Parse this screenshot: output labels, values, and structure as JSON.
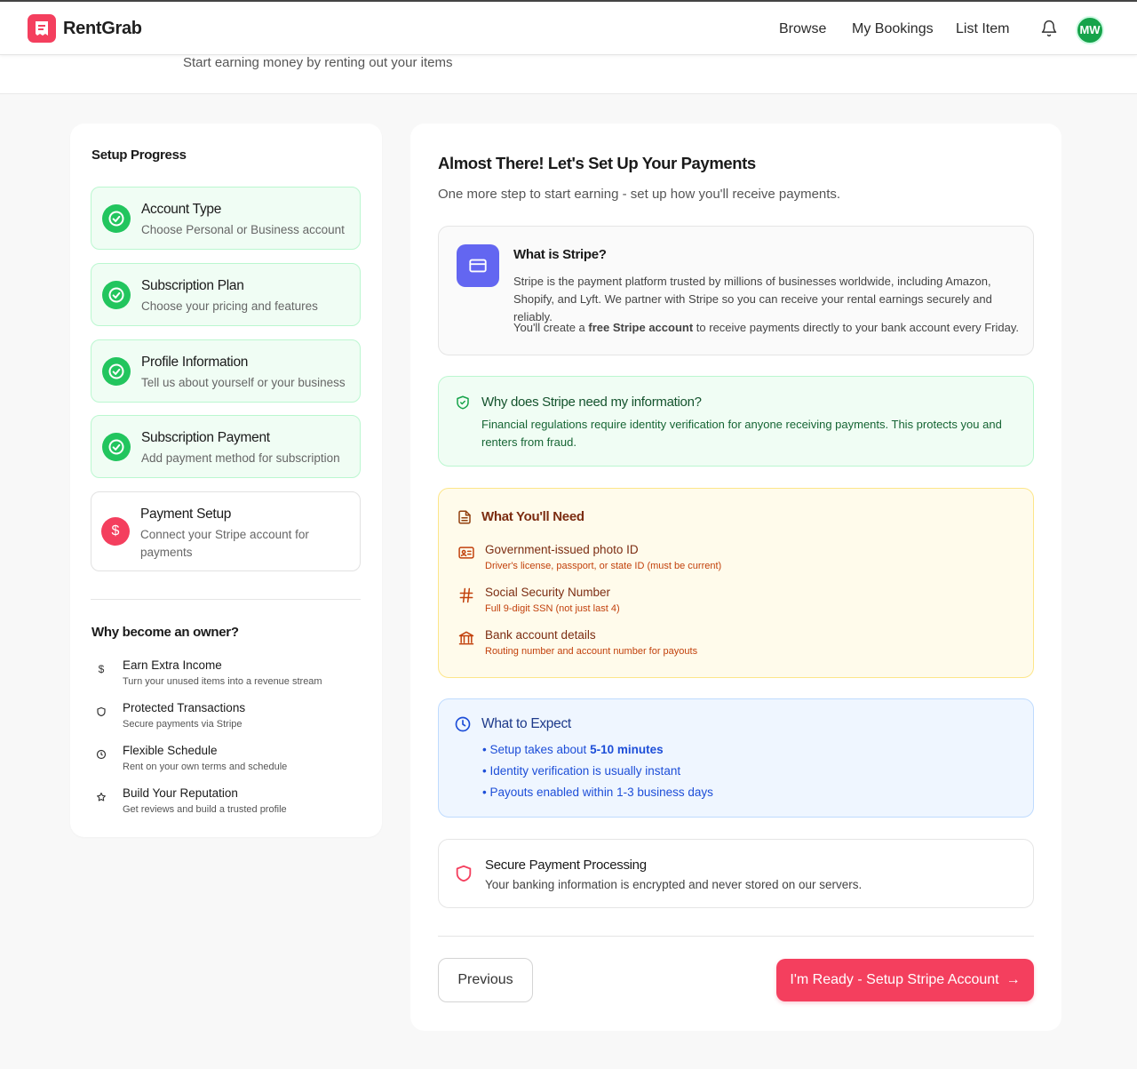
{
  "header": {
    "brand": "RentGrab",
    "nav": [
      "Browse",
      "My Bookings",
      "List Item"
    ],
    "avatar_initials": "MW"
  },
  "subheader": {
    "text": "Start earning money by renting out your items"
  },
  "sidebar": {
    "title": "Setup Progress",
    "steps": [
      {
        "title": "Account Type",
        "desc": "Choose Personal or Business account",
        "status": "complete"
      },
      {
        "title": "Subscription Plan",
        "desc": "Choose your pricing and features",
        "status": "complete"
      },
      {
        "title": "Profile Information",
        "desc": "Tell us about yourself or your business",
        "status": "complete"
      },
      {
        "title": "Subscription Payment",
        "desc": "Add payment method for subscription",
        "status": "complete"
      },
      {
        "title": "Payment Setup",
        "desc": "Connect your Stripe account for payments",
        "status": "current"
      }
    ],
    "why_title": "Why become an owner?",
    "benefits": [
      {
        "icon": "dollar-icon",
        "title": "Earn Extra Income",
        "desc": "Turn your unused items into a revenue stream"
      },
      {
        "icon": "shield-icon",
        "title": "Protected Transactions",
        "desc": "Secure payments via Stripe"
      },
      {
        "icon": "clock-icon",
        "title": "Flexible Schedule",
        "desc": "Rent on your own terms and schedule"
      },
      {
        "icon": "star-icon",
        "title": "Build Your Reputation",
        "desc": "Get reviews and build a trusted profile"
      }
    ]
  },
  "main": {
    "title": "Almost There! Let's Set Up Your Payments",
    "subtitle": "One more step to start earning - set up how you'll receive payments.",
    "stripe": {
      "title": "What is Stripe?",
      "body": "Stripe is the payment platform trusted by millions of businesses worldwide, including Amazon, Shopify, and Lyft. We partner with Stripe so you can receive your rental earnings securely and reliably.",
      "note_prefix": "You'll create a ",
      "note_bold": "free Stripe account",
      "note_suffix": " to receive payments directly to your bank account every Friday."
    },
    "why_info": {
      "title": "Why does Stripe need my information?",
      "body": "Financial regulations require identity verification for anyone receiving payments. This protects you and renters from fraud."
    },
    "needs": {
      "title": "What You'll Need",
      "items": [
        {
          "icon": "id-card-icon",
          "title": "Government-issued photo ID",
          "desc": "Driver's license, passport, or state ID (must be current)"
        },
        {
          "icon": "hash-icon",
          "title": "Social Security Number",
          "desc": "Full 9-digit SSN (not just last 4)"
        },
        {
          "icon": "bank-icon",
          "title": "Bank account details",
          "desc": "Routing number and account number for payouts"
        }
      ]
    },
    "expect": {
      "title": "What to Expect",
      "line1_prefix": "• Setup takes about ",
      "line1_bold": "5-10 minutes",
      "line2": "• Identity verification is usually instant",
      "line3": "• Payouts enabled within 1-3 business days"
    },
    "secure": {
      "title": "Secure Payment Processing",
      "body": "Your banking information is encrypted and never stored on our servers."
    },
    "buttons": {
      "previous": "Previous",
      "next": "I'm Ready - Setup Stripe Account"
    }
  },
  "colors": {
    "brand": "#f43f5e",
    "success": "#22c55e",
    "stripe": "#6366f1"
  }
}
